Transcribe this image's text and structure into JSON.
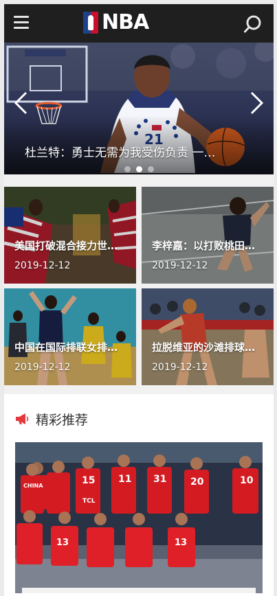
{
  "header": {
    "logo_text": "NBA",
    "menu_icon": "hamburger-menu-icon",
    "search_icon": "search-icon"
  },
  "hero": {
    "caption": "杜兰特：勇士无需为我受伤负责 一…",
    "slide_count": 3,
    "active_slide": 2,
    "jersey_number": "21"
  },
  "news": [
    {
      "title": "美国打破混合接力世…",
      "date": "2019-12-12"
    },
    {
      "title": "李梓嘉：以打败桃田…",
      "date": "2019-12-12"
    },
    {
      "title": "中国在国际排联女排…",
      "date": "2019-12-12"
    },
    {
      "title": "拉脱维亚的沙滩排球…",
      "date": "2019-12-12"
    }
  ],
  "recommend": {
    "title": "精彩推荐",
    "icon": "megaphone-icon",
    "jersey_text": "CHINA",
    "sponsor_text": "TCL"
  },
  "colors": {
    "header_bg": "#1f1f1f",
    "accent_red": "#e4393c",
    "nba_blue": "#1d428a",
    "nba_red": "#c8102e"
  }
}
